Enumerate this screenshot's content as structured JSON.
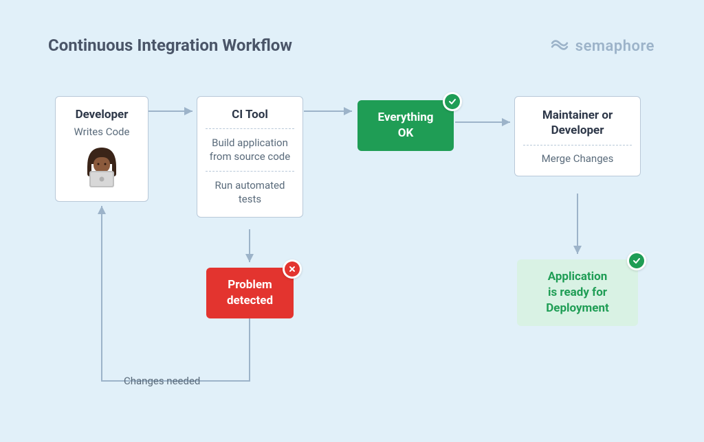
{
  "title": "Continuous Integration Workflow",
  "brand": "semaphore",
  "nodes": {
    "developer": {
      "title": "Developer",
      "subtitle": "Writes Code"
    },
    "citool": {
      "title": "CI Tool",
      "step1": "Build application from source code",
      "step2": "Run automated tests"
    },
    "ok": {
      "line1": "Everything",
      "line2": "OK"
    },
    "maintainer": {
      "title": "Maintainer or Developer",
      "action": "Merge Changes"
    },
    "problem": {
      "line1": "Problem",
      "line2": "detected"
    },
    "ready": {
      "line1": "Application",
      "line2": "is ready for",
      "line3": "Deployment"
    }
  },
  "labels": {
    "changes_needed": "Changes needed"
  },
  "colors": {
    "green": "#1F9D55",
    "red": "#E3342F",
    "light_green_bg": "#D9F2E4",
    "light_green_text": "#1F9D55",
    "arrow": "#9CB3C9"
  }
}
